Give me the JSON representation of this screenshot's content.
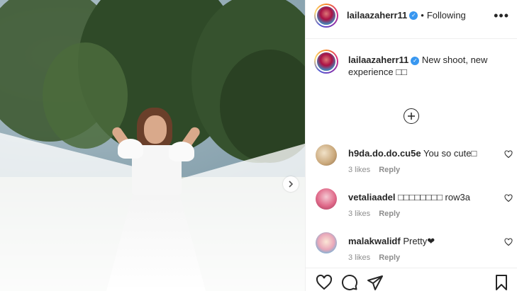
{
  "header": {
    "username": "lailaazaherr11",
    "verified_mark": "✓",
    "separator": "•",
    "follow_status": "Following",
    "more_label": "•••"
  },
  "caption": {
    "username": "lailaazaherr11",
    "verified_mark": "✓",
    "text": "New shoot, new experience □□"
  },
  "load_more": {
    "icon": "plus-circle-icon"
  },
  "comments": [
    {
      "username": "h9da.do.do.cu5e",
      "text": "You so cute□",
      "likes": "3 likes",
      "reply": "Reply"
    },
    {
      "username": "vetaliaadel",
      "text": "□□□□□□□□ row3a",
      "likes": "3 likes",
      "reply": "Reply"
    },
    {
      "username": "malakwalidf",
      "text": "Pretty❤",
      "likes": "3 likes",
      "reply": "Reply"
    }
  ],
  "actions": {
    "like": "heart-icon",
    "comment": "comment-icon",
    "share": "send-icon",
    "save": "bookmark-icon"
  },
  "colors": {
    "verified": "#3897f0",
    "text": "#262626",
    "muted": "#8e8e8e",
    "border": "#efefef"
  }
}
